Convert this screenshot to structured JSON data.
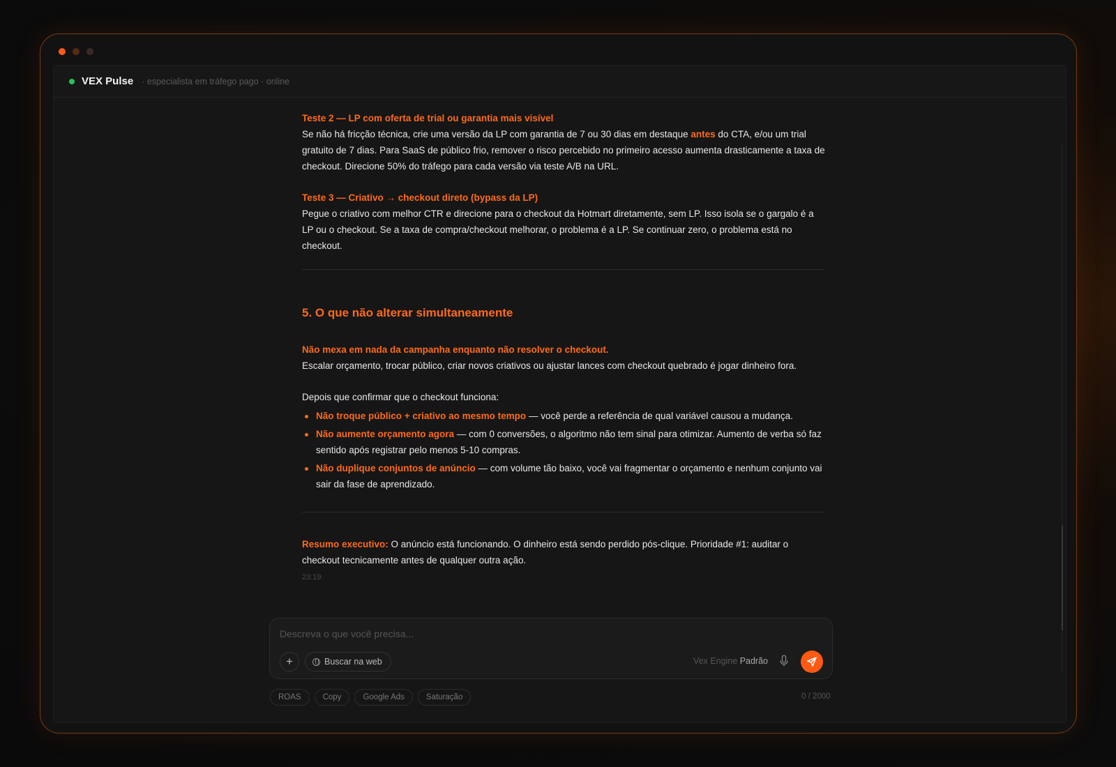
{
  "app": {
    "title": "VEX Pulse",
    "subtitle": "· especialista em tráfego pago · online"
  },
  "message": {
    "test2": {
      "heading": "Teste 2 — LP com oferta de trial ou garantia mais visível",
      "text_a": "Se não há fricção técnica, crie uma versão da LP com garantia de 7 ou 30 dias em destaque ",
      "highlight": "antes",
      "text_b": " do CTA, e/ou um trial gratuito de 7 dias. Para SaaS de público frio, remover o risco percebido no primeiro acesso aumenta drasticamente a taxa de checkout. Direcione 50% do tráfego para cada versão via teste A/B na URL."
    },
    "test3": {
      "heading": "Teste 3 — Criativo → checkout direto (bypass da LP)",
      "text": "Pegue o criativo com melhor CTR e direcione para o checkout da Hotmart diretamente, sem LP. Isso isola se o gargalo é a LP ou o checkout. Se a taxa de compra/checkout melhorar, o problema é a LP. Se continuar zero, o problema está no checkout."
    },
    "section5": {
      "heading": "5. O que não alterar simultaneamente",
      "warning": "Não mexa em nada da campanha enquanto não resolver o checkout.",
      "warning_text": "Escalar orçamento, trocar público, criar novos criativos ou ajustar lances com checkout quebrado é jogar dinheiro fora.",
      "intro": "Depois que confirmar que o checkout funciona:",
      "bullets": [
        {
          "strong": "Não troque público + criativo ao mesmo tempo",
          "text": " — você perde a referência de qual variável causou a mudança."
        },
        {
          "strong": "Não aumente orçamento agora",
          "text": " — com 0 conversões, o algoritmo não tem sinal para otimizar. Aumento de verba só faz sentido após registrar pelo menos 5-10 compras."
        },
        {
          "strong": "Não duplique conjuntos de anúncio",
          "text": " — com volume tão baixo, você vai fragmentar o orçamento e nenhum conjunto vai sair da fase de aprendizado."
        }
      ]
    },
    "summary": {
      "label": "Resumo executivo:",
      "text": " O anúncio está funcionando. O dinheiro está sendo perdido pós-clique. Prioridade #1: auditar o checkout tecnicamente antes de qualquer outra ação."
    },
    "time": "23:19"
  },
  "composer": {
    "placeholder": "Descreva o que você precisa...",
    "value": "",
    "web_search_label": "Buscar na web",
    "engine_label": "Vex Engine",
    "engine_value": "Padrão",
    "icons": {
      "plus": "plus-icon",
      "globe": "globe-icon",
      "mic": "mic-icon",
      "send": "send-icon"
    }
  },
  "chips": [
    "ROAS",
    "Copy",
    "Google Ads",
    "Saturação"
  ],
  "counter": "0 / 2000",
  "colors": {
    "accent": "#ff6a1a",
    "status": "#22c55e",
    "background": "#161616"
  }
}
